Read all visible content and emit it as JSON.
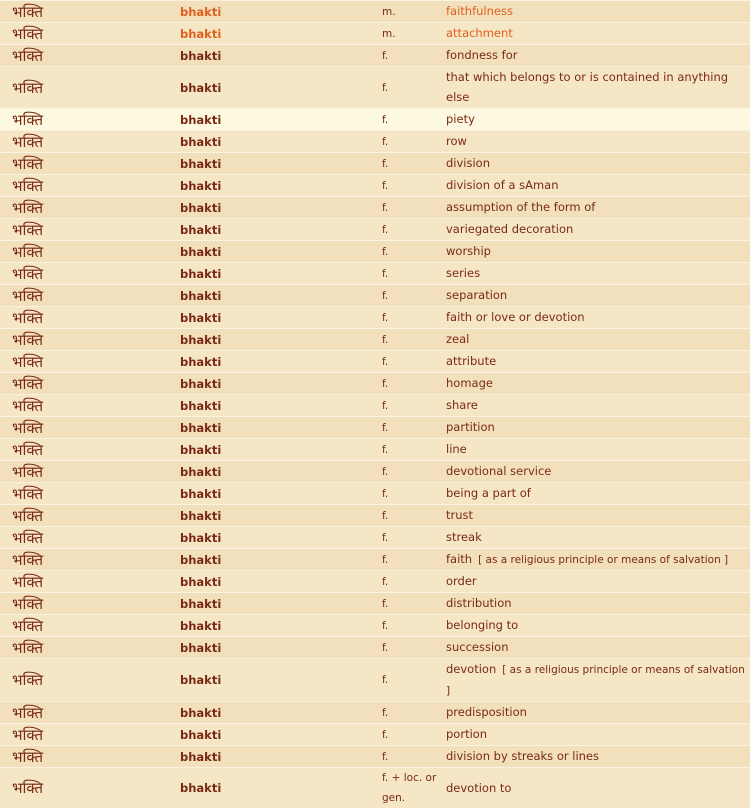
{
  "entries": [
    {
      "dev": "भक्ति",
      "translit": "bhakti",
      "gram": "m.",
      "meaning": "faithfulness",
      "note": "",
      "style": "orange"
    },
    {
      "dev": "भक्ति",
      "translit": "bhakti",
      "gram": "m.",
      "meaning": "attachment",
      "note": "",
      "style": "orange"
    },
    {
      "dev": "भक्ति",
      "translit": "bhakti",
      "gram": "f.",
      "meaning": "fondness for",
      "note": "",
      "style": ""
    },
    {
      "dev": "भक्ति",
      "translit": "bhakti",
      "gram": "f.",
      "meaning": "that which belongs to or is contained in anything else",
      "note": "",
      "style": ""
    },
    {
      "dev": "भक्ति",
      "translit": "bhakti",
      "gram": "f.",
      "meaning": "piety",
      "note": "",
      "style": "hl"
    },
    {
      "dev": "भक्ति",
      "translit": "bhakti",
      "gram": "f.",
      "meaning": "row",
      "note": "",
      "style": ""
    },
    {
      "dev": "भक्ति",
      "translit": "bhakti",
      "gram": "f.",
      "meaning": "division",
      "note": "",
      "style": ""
    },
    {
      "dev": "भक्ति",
      "translit": "bhakti",
      "gram": "f.",
      "meaning": "division of a sAman",
      "note": "",
      "style": ""
    },
    {
      "dev": "भक्ति",
      "translit": "bhakti",
      "gram": "f.",
      "meaning": "assumption of the form of",
      "note": "",
      "style": ""
    },
    {
      "dev": "भक्ति",
      "translit": "bhakti",
      "gram": "f.",
      "meaning": "variegated decoration",
      "note": "",
      "style": ""
    },
    {
      "dev": "भक्ति",
      "translit": "bhakti",
      "gram": "f.",
      "meaning": "worship",
      "note": "",
      "style": ""
    },
    {
      "dev": "भक्ति",
      "translit": "bhakti",
      "gram": "f.",
      "meaning": "series",
      "note": "",
      "style": ""
    },
    {
      "dev": "भक्ति",
      "translit": "bhakti",
      "gram": "f.",
      "meaning": "separation",
      "note": "",
      "style": ""
    },
    {
      "dev": "भक्ति",
      "translit": "bhakti",
      "gram": "f.",
      "meaning": "faith or love or devotion",
      "note": "",
      "style": ""
    },
    {
      "dev": "भक्ति",
      "translit": "bhakti",
      "gram": "f.",
      "meaning": "zeal",
      "note": "",
      "style": ""
    },
    {
      "dev": "भक्ति",
      "translit": "bhakti",
      "gram": "f.",
      "meaning": "attribute",
      "note": "",
      "style": ""
    },
    {
      "dev": "भक्ति",
      "translit": "bhakti",
      "gram": "f.",
      "meaning": "homage",
      "note": "",
      "style": ""
    },
    {
      "dev": "भक्ति",
      "translit": "bhakti",
      "gram": "f.",
      "meaning": "share",
      "note": "",
      "style": ""
    },
    {
      "dev": "भक्ति",
      "translit": "bhakti",
      "gram": "f.",
      "meaning": "partition",
      "note": "",
      "style": ""
    },
    {
      "dev": "भक्ति",
      "translit": "bhakti",
      "gram": "f.",
      "meaning": "line",
      "note": "",
      "style": ""
    },
    {
      "dev": "भक्ति",
      "translit": "bhakti",
      "gram": "f.",
      "meaning": "devotional service",
      "note": "",
      "style": ""
    },
    {
      "dev": "भक्ति",
      "translit": "bhakti",
      "gram": "f.",
      "meaning": "being a part of",
      "note": "",
      "style": ""
    },
    {
      "dev": "भक्ति",
      "translit": "bhakti",
      "gram": "f.",
      "meaning": "trust",
      "note": "",
      "style": ""
    },
    {
      "dev": "भक्ति",
      "translit": "bhakti",
      "gram": "f.",
      "meaning": "streak",
      "note": "",
      "style": ""
    },
    {
      "dev": "भक्ति",
      "translit": "bhakti",
      "gram": "f.",
      "meaning": "faith",
      "note": "[ as a religious principle or means of salvation ]",
      "style": ""
    },
    {
      "dev": "भक्ति",
      "translit": "bhakti",
      "gram": "f.",
      "meaning": "order",
      "note": "",
      "style": ""
    },
    {
      "dev": "भक्ति",
      "translit": "bhakti",
      "gram": "f.",
      "meaning": "distribution",
      "note": "",
      "style": ""
    },
    {
      "dev": "भक्ति",
      "translit": "bhakti",
      "gram": "f.",
      "meaning": "belonging to",
      "note": "",
      "style": ""
    },
    {
      "dev": "भक्ति",
      "translit": "bhakti",
      "gram": "f.",
      "meaning": "succession",
      "note": "",
      "style": ""
    },
    {
      "dev": "भक्ति",
      "translit": "bhakti",
      "gram": "f.",
      "meaning": "devotion",
      "note": "[ as a religious principle or means of salvation ]",
      "style": ""
    },
    {
      "dev": "भक्ति",
      "translit": "bhakti",
      "gram": "f.",
      "meaning": "predisposition",
      "note": "",
      "style": ""
    },
    {
      "dev": "भक्ति",
      "translit": "bhakti",
      "gram": "f.",
      "meaning": "portion",
      "note": "",
      "style": ""
    },
    {
      "dev": "भक्ति",
      "translit": "bhakti",
      "gram": "f.",
      "meaning": "division by streaks or lines",
      "note": "",
      "style": ""
    },
    {
      "dev": "भक्ति",
      "translit": "bhakti",
      "gram": "f. + loc. or gen.",
      "meaning": "devotion to",
      "note": "",
      "style": ""
    }
  ]
}
